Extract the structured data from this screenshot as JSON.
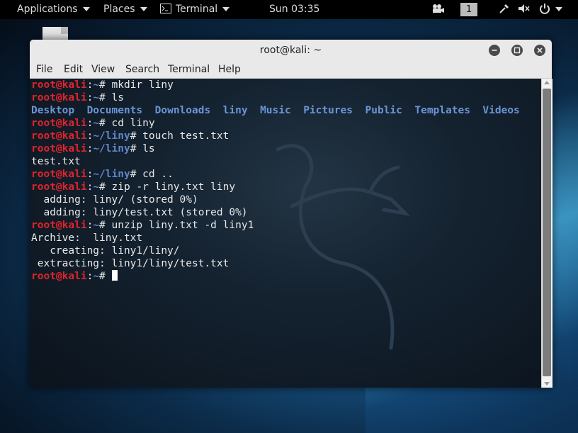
{
  "top_panel": {
    "applications": "Applications",
    "places": "Places",
    "terminal_app": "Terminal",
    "clock": "Sun 03:35",
    "workspace": "1"
  },
  "window": {
    "title": "root@kali: ~"
  },
  "menubar": {
    "file": "File",
    "edit": "Edit",
    "view": "View",
    "search": "Search",
    "terminal": "Terminal",
    "help": "Help"
  },
  "terminal": {
    "user_host": "root@kali",
    "lines": [
      {
        "type": "prompt",
        "path": "~",
        "cmd": " mkdir liny"
      },
      {
        "type": "prompt",
        "path": "~",
        "cmd": " ls"
      },
      {
        "type": "dirs",
        "items": [
          "Desktop",
          "Documents",
          "Downloads",
          "liny",
          "Music",
          "Pictures",
          "Public",
          "Templates",
          "Videos"
        ]
      },
      {
        "type": "prompt",
        "path": "~",
        "cmd": " cd liny"
      },
      {
        "type": "prompt",
        "path": "~/liny",
        "cmd": " touch test.txt"
      },
      {
        "type": "prompt",
        "path": "~/liny",
        "cmd": " ls"
      },
      {
        "type": "out",
        "text": "test.txt"
      },
      {
        "type": "prompt",
        "path": "~/liny",
        "cmd": " cd .."
      },
      {
        "type": "prompt",
        "path": "~",
        "cmd": " zip -r liny.txt liny"
      },
      {
        "type": "out",
        "text": "  adding: liny/ (stored 0%)"
      },
      {
        "type": "out",
        "text": "  adding: liny/test.txt (stored 0%)"
      },
      {
        "type": "prompt",
        "path": "~",
        "cmd": " unzip liny.txt -d liny1"
      },
      {
        "type": "out",
        "text": "Archive:  liny.txt"
      },
      {
        "type": "out",
        "text": "   creating: liny1/liny/"
      },
      {
        "type": "out",
        "text": " extracting: liny1/liny/test.txt"
      },
      {
        "type": "prompt",
        "path": "~",
        "cmd": " ",
        "cursor": true
      }
    ]
  },
  "colors": {
    "prompt_user": "#e0242c",
    "prompt_path": "#5e86c8",
    "directory": "#6a95d6"
  }
}
